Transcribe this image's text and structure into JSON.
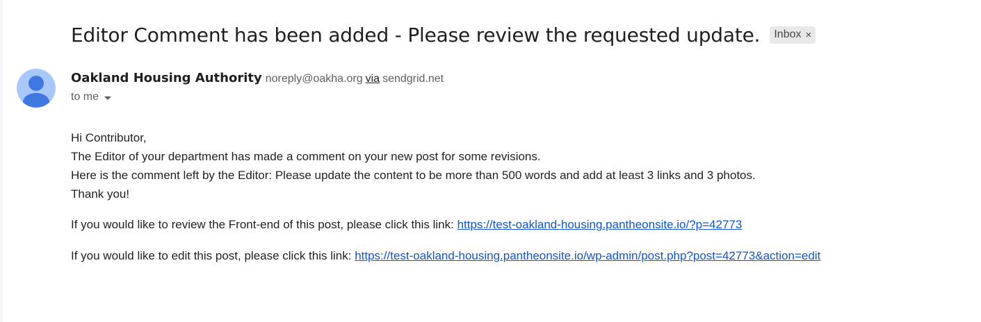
{
  "email": {
    "subject": "Editor Comment has been added - Please review the requested update.",
    "label": "Inbox",
    "label_remove": "×",
    "sender": {
      "name": "Oakland Housing Authority",
      "email": "noreply@oakha.org",
      "via": "via",
      "via_domain": "sendgrid.net"
    },
    "recipient": "to me",
    "body": {
      "greeting": "Hi Contributor,",
      "line1": "The Editor of your department has made a comment on your new post for some revisions.",
      "line2": "Here is the comment left by the Editor: Please update the content to be more than 500 words and add at least 3 links and 3 photos.",
      "line3": "Thank you!",
      "review_text": "If you would like to review the Front-end of this post, please click this link: ",
      "review_link": "https://test-oakland-housing.pantheonsite.io/?p=42773",
      "edit_text": "If you would like to edit this post, please click this link: ",
      "edit_link": "https://test-oakland-housing.pantheonsite.io/wp-admin/post.php?post=42773&action=edit"
    }
  },
  "colors": {
    "avatar_bg": "#a8c7fa",
    "avatar_fg": "#3f78e0",
    "link": "#1155cc",
    "chip_bg": "#e8e8e8"
  },
  "icons": {
    "avatar": "person-icon",
    "recipient_details": "caret-down-icon",
    "remove_label": "close-icon"
  }
}
